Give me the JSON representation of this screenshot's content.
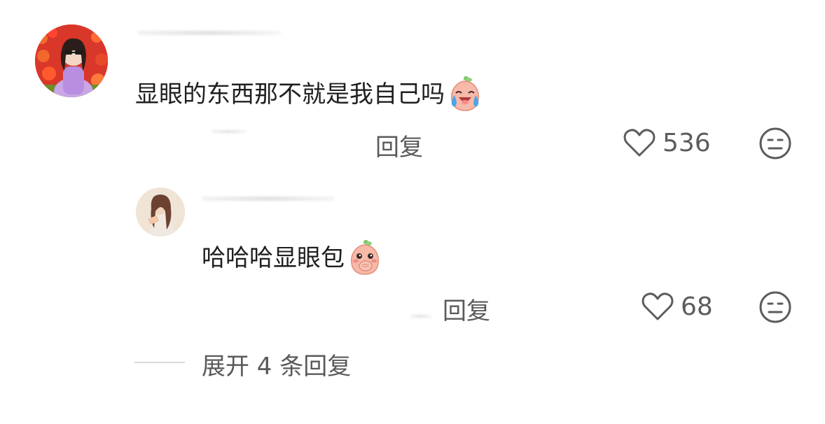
{
  "comment": {
    "text": "显眼的东西那不就是我自己吗",
    "emoji": "laughing-crying-peach-emoji",
    "reply_label": "回复",
    "like_count": "536"
  },
  "reply": {
    "text": "哈哈哈显眼包",
    "emoji": "giggling-peach-emoji",
    "reply_label": "回复",
    "like_count": "68"
  },
  "thread": {
    "expand_label": "展开 4 条回复"
  },
  "colors": {
    "text": "#1f1f1f",
    "secondary": "#5a5a5a",
    "emoji_peach": "#f6b3a2"
  }
}
